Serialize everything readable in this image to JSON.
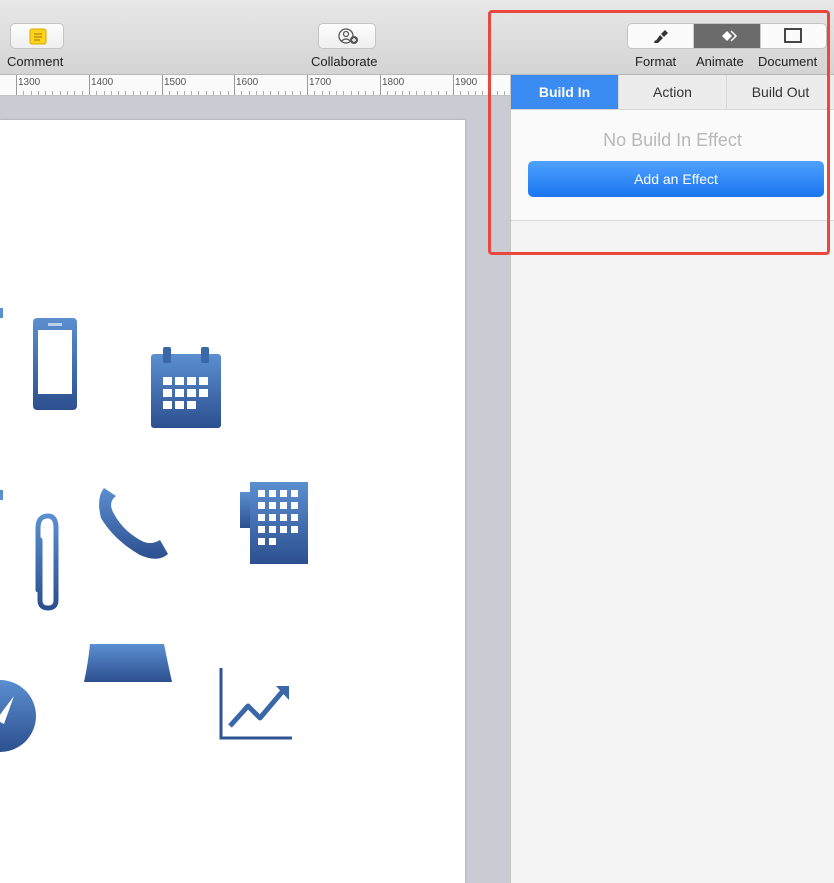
{
  "toolbar": {
    "comment_label": "Comment",
    "collaborate_label": "Collaborate",
    "format_label": "Format",
    "animate_label": "Animate",
    "document_label": "Document"
  },
  "ruler": {
    "ticks": [
      "1300",
      "1400",
      "1500",
      "1600",
      "1700",
      "1800",
      "1900"
    ]
  },
  "inspector": {
    "tabs": [
      {
        "label": "Build In",
        "active": true
      },
      {
        "label": "Action",
        "active": false
      },
      {
        "label": "Build Out",
        "active": false
      }
    ],
    "no_effect_text": "No Build In Effect",
    "add_effect_label": "Add an Effect"
  },
  "colors": {
    "accent": "#2c86f5",
    "icon_blue": "#3d6fb3",
    "highlight": "#e9483f"
  },
  "slide_icons": [
    "smartphone-icon",
    "calendar-icon",
    "paperclip-icon",
    "phone-handset-icon",
    "office-building-icon",
    "banner-shape-icon",
    "growth-chart-icon",
    "compass-icon"
  ]
}
